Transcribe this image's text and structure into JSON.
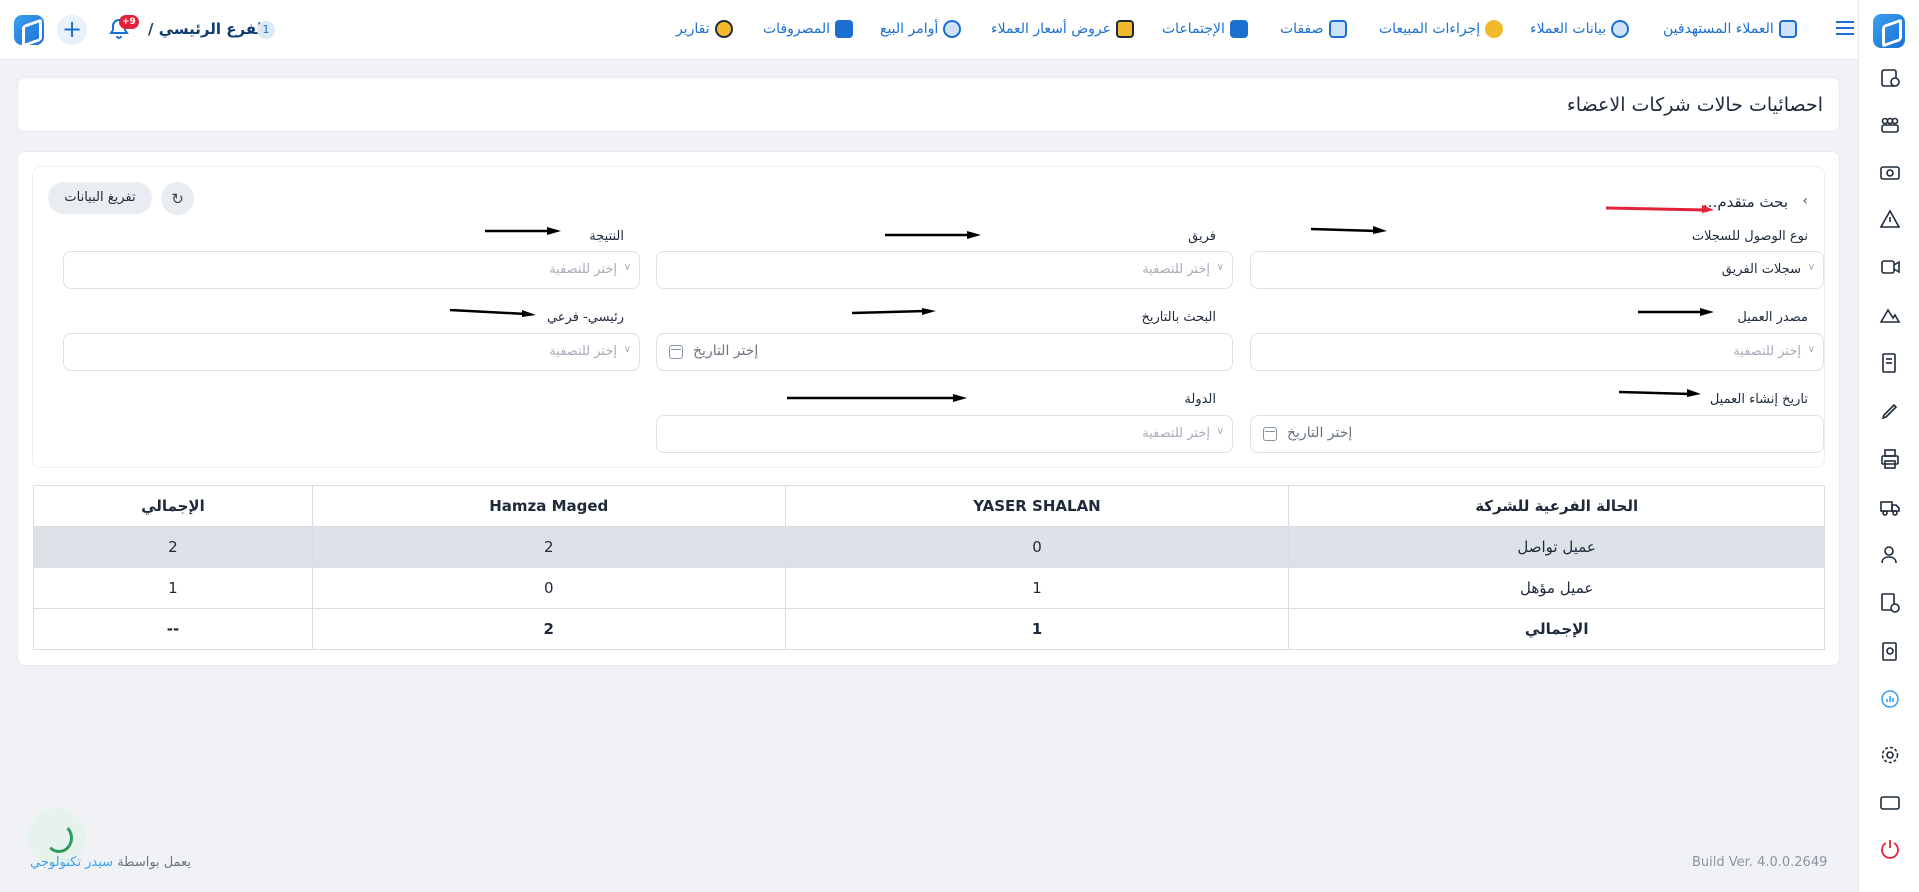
{
  "topbar": {
    "branch_label": "الفرع الرئيسي /",
    "branch_count": "1",
    "notifications_count": "+9",
    "nav": [
      {
        "label": "العملاء المستهدفين",
        "icon": "target-customers-icon",
        "color": "#1b6fd1"
      },
      {
        "label": "بيانات العملاء",
        "icon": "customer-data-icon",
        "color": "#1b6fd1"
      },
      {
        "label": "إجراءات المبيعات",
        "icon": "sales-actions-icon",
        "color": "#f2b92c"
      },
      {
        "label": "صفقات",
        "icon": "deals-icon",
        "color": "#1b6fd1"
      },
      {
        "label": "الإجتماعات",
        "icon": "meetings-icon",
        "color": "#1b6fd1"
      },
      {
        "label": "عروض أسعار العملاء",
        "icon": "quotes-icon",
        "color": "#f2b92c"
      },
      {
        "label": "أوامر البيع",
        "icon": "sales-orders-icon",
        "color": "#1b6fd1"
      },
      {
        "label": "المصروفات",
        "icon": "expenses-icon",
        "color": "#1b6fd1"
      },
      {
        "label": "تقارير",
        "icon": "reports-icon",
        "color": "#f2b92c"
      }
    ]
  },
  "page": {
    "title": "احصائيات حالات شركات الاعضاء"
  },
  "filters": {
    "advanced_search_title": "بحث متقدم...",
    "clear_button": "تفريغ البيانات",
    "fields": {
      "access_type": {
        "label": "نوع الوصول للسجلات",
        "value": "سجلات الفريق"
      },
      "team": {
        "label": "فريق",
        "placeholder": "إختر للتصفية"
      },
      "result": {
        "label": "النتيجة",
        "placeholder": "إختر للتصفية"
      },
      "client_source": {
        "label": "مصدر العميل",
        "placeholder": "إختر للتصفية"
      },
      "search_by_date": {
        "label": "البحث بالتاريخ",
        "placeholder": "إختر التاريخ"
      },
      "main_sub": {
        "label": "رئيسي- فرعي",
        "placeholder": "إختر للتصفية"
      },
      "client_created_date": {
        "label": "تاريخ إنشاء العميل",
        "placeholder": "إختر التاريخ"
      },
      "country": {
        "label": "الدولة",
        "placeholder": "إختر للتصفية"
      }
    }
  },
  "table": {
    "headers": [
      "الحالة الفرعية للشركة",
      "YASER SHALAN",
      "Hamza Maged",
      "الإجمالي"
    ],
    "rows": [
      [
        "عميل تواصل",
        "0",
        "2",
        "2"
      ],
      [
        "عميل مؤهل",
        "1",
        "0",
        "1"
      ]
    ],
    "total_row": [
      "الإجمالي",
      "1",
      "2",
      "--"
    ]
  },
  "footer": {
    "powered_prefix": "يعمل بواسطة",
    "powered_link": "سيدر تكنولوجي",
    "build": "Build Ver. 4.0.0.2649"
  },
  "colors": {
    "primary": "#1b6fd1",
    "accent": "#f2b92c",
    "danger": "#e5213a",
    "success": "#2b9c5c"
  }
}
